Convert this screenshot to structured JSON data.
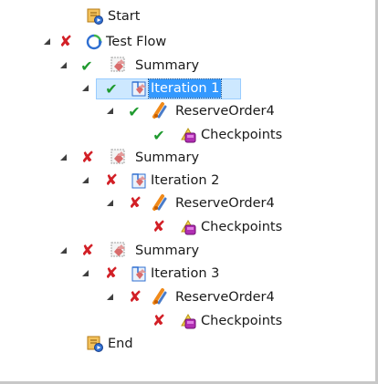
{
  "tree": {
    "nodes": [
      {
        "label": "Start",
        "status": null,
        "icon": "flow-endpoint-icon",
        "expander": null,
        "depth": 0
      },
      {
        "label": "Test Flow",
        "status": "failed",
        "icon": "test-flow-icon",
        "expander": "expanded",
        "depth": 0
      },
      {
        "label": "Summary",
        "status": "passed",
        "icon": "summary-icon",
        "expander": "expanded",
        "depth": 1
      },
      {
        "label": "Iteration 1",
        "status": "passed",
        "icon": "iteration-icon",
        "expander": "expanded",
        "depth": 2,
        "selected": true
      },
      {
        "label": "ReserveOrder4",
        "status": "passed",
        "icon": "business-component-icon",
        "expander": "expanded",
        "depth": 3
      },
      {
        "label": "Checkpoints",
        "status": "passed",
        "icon": "checkpoints-icon",
        "expander": null,
        "depth": 4
      },
      {
        "label": "Summary",
        "status": "failed",
        "icon": "summary-icon",
        "expander": "expanded",
        "depth": 1
      },
      {
        "label": "Iteration 2",
        "status": "failed",
        "icon": "iteration-icon",
        "expander": "expanded",
        "depth": 2
      },
      {
        "label": "ReserveOrder4",
        "status": "failed",
        "icon": "business-component-icon",
        "expander": "expanded",
        "depth": 3
      },
      {
        "label": "Checkpoints",
        "status": "failed",
        "icon": "checkpoints-icon",
        "expander": null,
        "depth": 4
      },
      {
        "label": "Summary",
        "status": "failed",
        "icon": "summary-icon",
        "expander": "expanded",
        "depth": 1
      },
      {
        "label": "Iteration 3",
        "status": "failed",
        "icon": "iteration-icon",
        "expander": "expanded",
        "depth": 2
      },
      {
        "label": "ReserveOrder4",
        "status": "failed",
        "icon": "business-component-icon",
        "expander": "expanded",
        "depth": 3
      },
      {
        "label": "Checkpoints",
        "status": "failed",
        "icon": "checkpoints-icon",
        "expander": null,
        "depth": 4
      },
      {
        "label": "End",
        "status": null,
        "icon": "flow-endpoint-icon",
        "expander": null,
        "depth": 0
      }
    ],
    "selected_index": 3
  },
  "colors": {
    "passed": "#1f9a2f",
    "failed": "#d21f26",
    "selection": "#3399ff"
  }
}
